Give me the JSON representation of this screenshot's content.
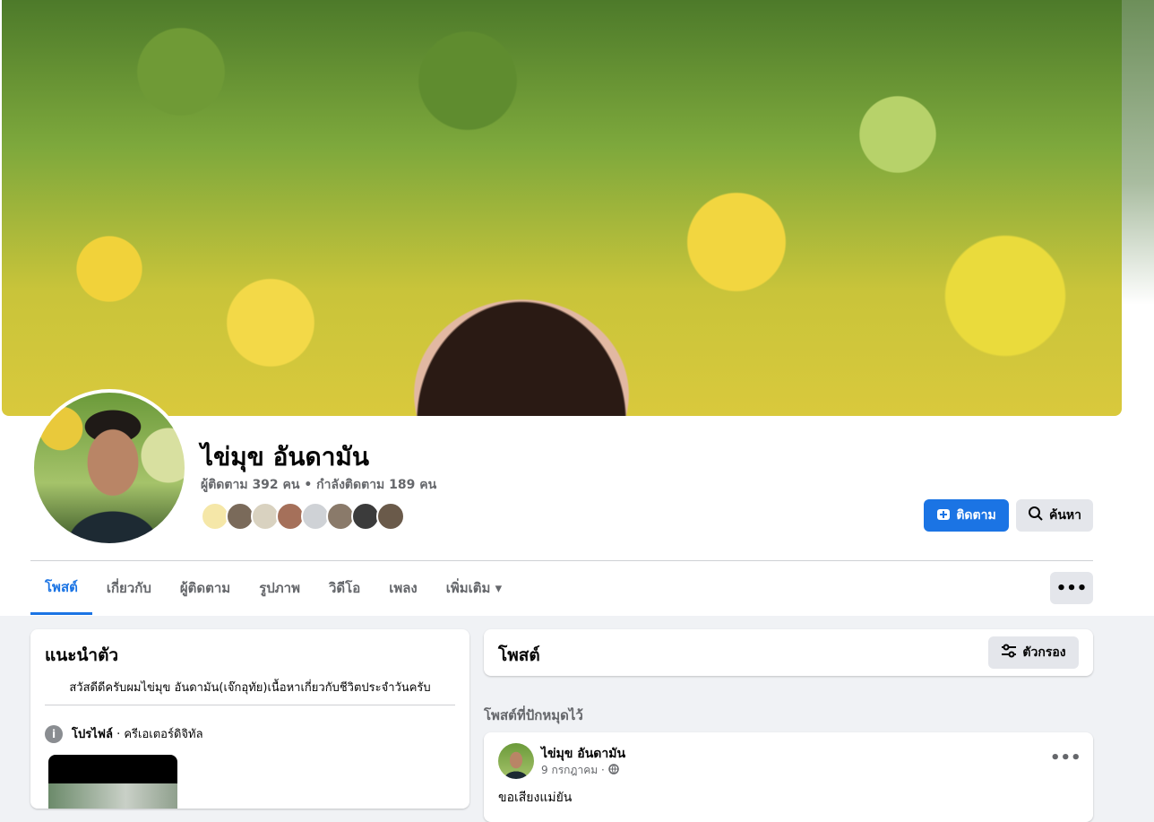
{
  "profile": {
    "name": "ไข่มุข อันดามัน",
    "stats": "ผู้ติดตาม 392 คน • กำลังติดตาม 189 คน",
    "follow_label": "ติดตาม",
    "search_label": "ค้นหา"
  },
  "follower_avatars": [
    "#f5e7a8",
    "#7a6a5a",
    "#d9d2c0",
    "#a5705a",
    "#cfd2d6",
    "#8a7a6a",
    "#3b3b3b",
    "#6a5a4a"
  ],
  "tabs": [
    {
      "label": "โพสต์",
      "active": true
    },
    {
      "label": "เกี่ยวกับ",
      "active": false
    },
    {
      "label": "ผู้ติดตาม",
      "active": false
    },
    {
      "label": "รูปภาพ",
      "active": false
    },
    {
      "label": "วิดีโอ",
      "active": false
    },
    {
      "label": "เพลง",
      "active": false
    },
    {
      "label": "เพิ่มเติม ▾",
      "active": false
    }
  ],
  "more_label": "•••",
  "intro": {
    "title": "แนะนำตัว",
    "bio": "สวัสดีดีครับผมไข่มุข อันดามัน(เจ๊กอุทัย)เนื้อหาเกี่ยวกับชีวิตประจำวันครับ",
    "profile_label": "โปรไฟล์",
    "profile_value": " · ครีเอเตอร์ดิจิทัล"
  },
  "posts": {
    "title": "โพสต์",
    "filter_label": "ตัวกรอง",
    "pinned_label": "โพสต์ที่ปักหมุดไว้"
  },
  "post": {
    "author": "ไข่มุข อันดามัน",
    "date": "9 กรกฎาคม ·",
    "text": "ขอเสียงแม่ยัน"
  },
  "colors": {
    "accent": "#1b74e4",
    "muted": "#65676b",
    "page_bg": "#f0f2f5"
  }
}
